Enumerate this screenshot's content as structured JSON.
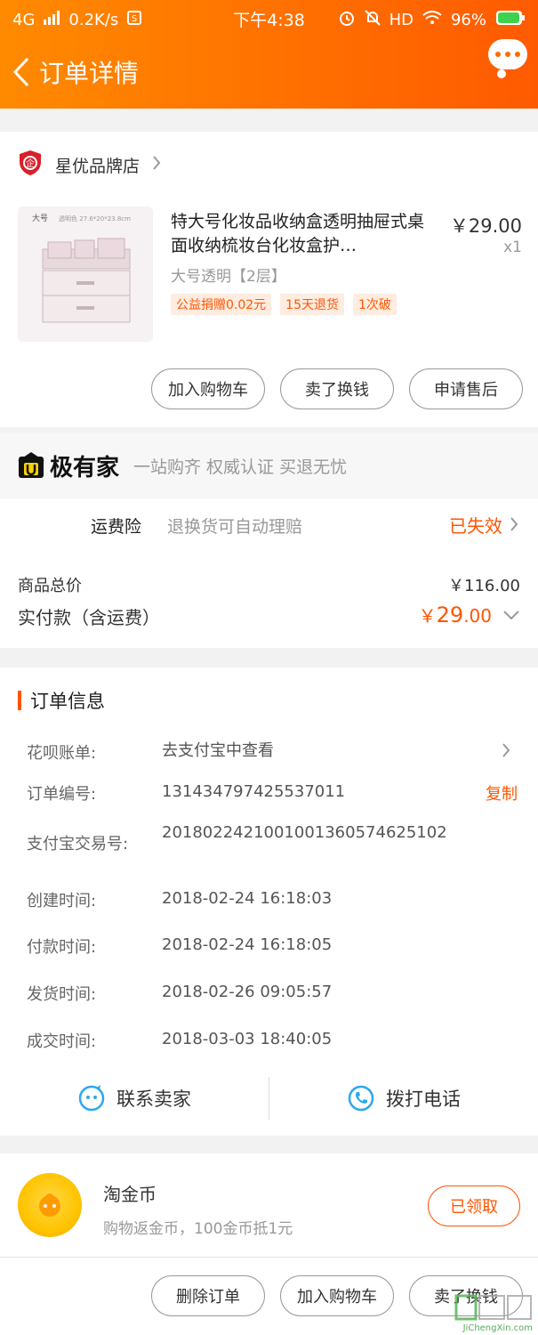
{
  "status_bar": {
    "network": "4G",
    "speed": "0.2K/s",
    "time": "下午4:38",
    "hd": "HD",
    "battery": "96%"
  },
  "header": {
    "title": "订单详情"
  },
  "shop": {
    "name": "星优品牌店"
  },
  "product": {
    "title": "特大号化妆品收纳盒透明抽屉式桌面收纳梳妆台化妆盒护…",
    "price": "￥29.00",
    "qty": "x1",
    "spec": "大号透明【2层】",
    "tags": [
      "公益捐赠0.02元",
      "15天退货",
      "1次破"
    ],
    "image_label_top": "大号",
    "image_label_dims": "透明色 27.6*20*23.8cm"
  },
  "item_actions": {
    "add_cart": "加入购物车",
    "sell": "卖了换钱",
    "after_sale": "申请售后"
  },
  "brand_band": {
    "logo_text": "极有家",
    "slogan": "一站购齐 权威认证 买退无忧"
  },
  "insurance": {
    "label": "运费险",
    "desc": "退换货可自动理赔",
    "status": "已失效"
  },
  "summary": {
    "goods_total_label": "商品总价",
    "goods_total_value": "￥116.00",
    "paid_label": "实付款（含运费）",
    "paid_currency": "￥",
    "paid_int": "29",
    "paid_dec": ".00"
  },
  "order_info": {
    "heading": "订单信息",
    "rows": [
      {
        "key": "花呗账单:",
        "value": "去支付宝中查看"
      },
      {
        "key": "订单编号:",
        "value": "131434797425537011"
      },
      {
        "key": "支付宝交易号:",
        "value": "2018022421001001360574625102"
      },
      {
        "key": "创建时间:",
        "value": "2018-02-24 16:18:03"
      },
      {
        "key": "付款时间:",
        "value": "2018-02-24 16:18:05"
      },
      {
        "key": "发货时间:",
        "value": "2018-02-26 09:05:57"
      },
      {
        "key": "成交时间:",
        "value": "2018-03-03 18:40:05"
      }
    ],
    "copy_label": "复制"
  },
  "contact": {
    "seller": "联系卖家",
    "phone": "拨打电话"
  },
  "coins": {
    "title": "淘金币",
    "desc": "购物返金币，100金币抵1元",
    "button": "已领取"
  },
  "bottom_actions": {
    "delete": "删除订单",
    "add_cart": "加入购物车",
    "sell": "卖了换钱"
  },
  "watermark": {
    "text": "JiChengXin.com"
  },
  "colors": {
    "accent": "#ff5500",
    "header_start": "#ff8a00",
    "header_end": "#ff5a00"
  }
}
